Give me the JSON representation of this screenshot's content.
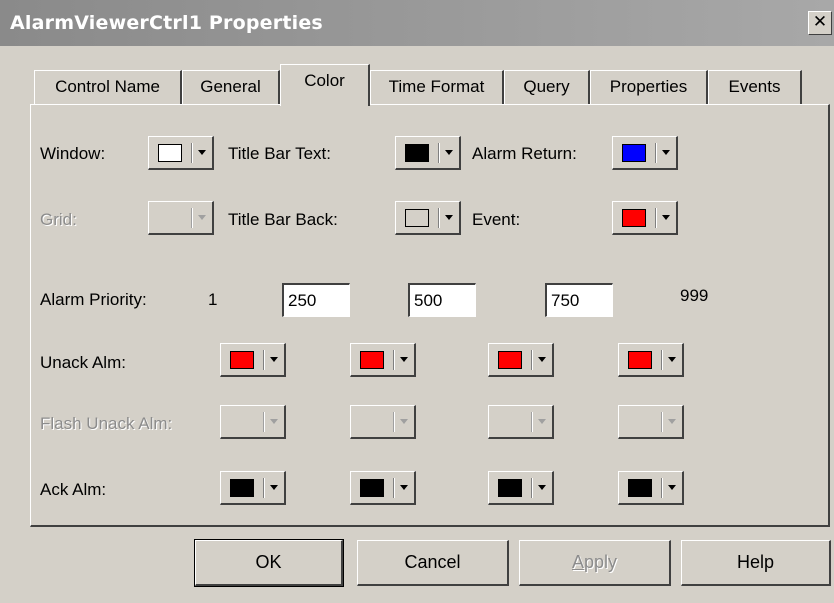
{
  "window": {
    "title": "AlarmViewerCtrl1 Properties",
    "close_glyph": "✕"
  },
  "tabs": [
    {
      "label": "Control Name"
    },
    {
      "label": "General"
    },
    {
      "label": "Color"
    },
    {
      "label": "Time Format"
    },
    {
      "label": "Query"
    },
    {
      "label": "Properties"
    },
    {
      "label": "Events"
    }
  ],
  "active_tab": "Color",
  "colors_row": {
    "window_label": "Window:",
    "window_color": "#ffffff",
    "title_bar_text_label": "Title Bar Text:",
    "title_bar_text_color": "#000000",
    "alarm_return_label": "Alarm Return:",
    "alarm_return_color": "#0000ff",
    "grid_label": "Grid:",
    "title_bar_back_label": "Title Bar Back:",
    "title_bar_back_color": "#d4d0c8",
    "event_label": "Event:",
    "event_color": "#ff0000"
  },
  "priority": {
    "label": "Alarm Priority:",
    "start": "1",
    "inputs": [
      "250",
      "500",
      "750"
    ],
    "end": "999"
  },
  "rows": {
    "unack_label": "Unack Alm:",
    "unack_colors": [
      "#ff0000",
      "#ff0000",
      "#ff0000",
      "#ff0000"
    ],
    "flash_label": "Flash Unack Alm:",
    "ack_label": "Ack Alm:",
    "ack_colors": [
      "#000000",
      "#000000",
      "#000000",
      "#000000"
    ]
  },
  "buttons": {
    "ok": "OK",
    "cancel": "Cancel",
    "apply_first": "A",
    "apply_rest": "pply",
    "help": "Help"
  }
}
